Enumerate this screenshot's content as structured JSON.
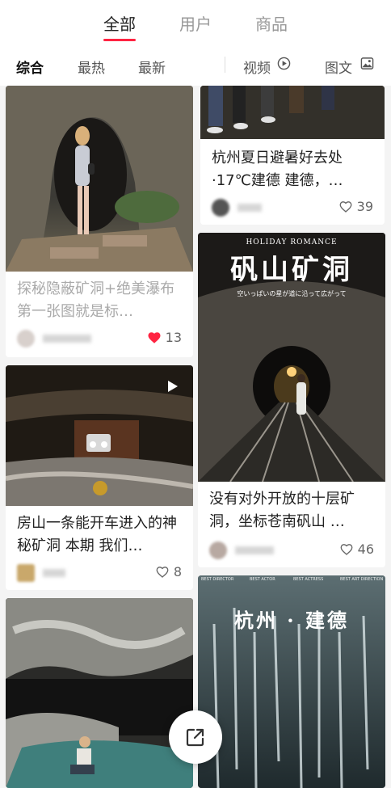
{
  "top_tabs": [
    "全部",
    "用户",
    "商品"
  ],
  "filters": {
    "items": [
      "综合",
      "最热",
      "最新"
    ],
    "video_label": "视频",
    "image_text_label": "图文"
  },
  "cards": [
    {
      "title": "探秘隐蔽矿洞+绝美瀑布 第一张图就是标…",
      "likes": "13",
      "liked": true
    },
    {
      "title": "房山一条能开车进入的神秘矿洞 本期 我们…",
      "likes": "8",
      "liked": false,
      "is_video": true
    },
    {
      "title": "杭州夏日避暑好去处·17℃建德 建德，…",
      "likes": "39",
      "liked": false
    },
    {
      "title": "没有对外开放的十层矿洞，坐标苍南矾山 …",
      "likes": "46",
      "liked": false,
      "image_overlay_title": "矾山矿洞",
      "image_overlay_top": "HOLIDAY ROMANCE",
      "image_overlay_sub": "空いっぱいの星が道に沿って広がって"
    },
    {
      "image_overlay_title": "杭州 · 建德",
      "image_credits": [
        "BEST DIRECTOR",
        "BEST ACTOR",
        "BEST ACTRESS",
        "BEST ART DIRECTION"
      ]
    }
  ],
  "colors": {
    "accent": "#ff2442",
    "text": "#222222",
    "muted": "#999999"
  }
}
